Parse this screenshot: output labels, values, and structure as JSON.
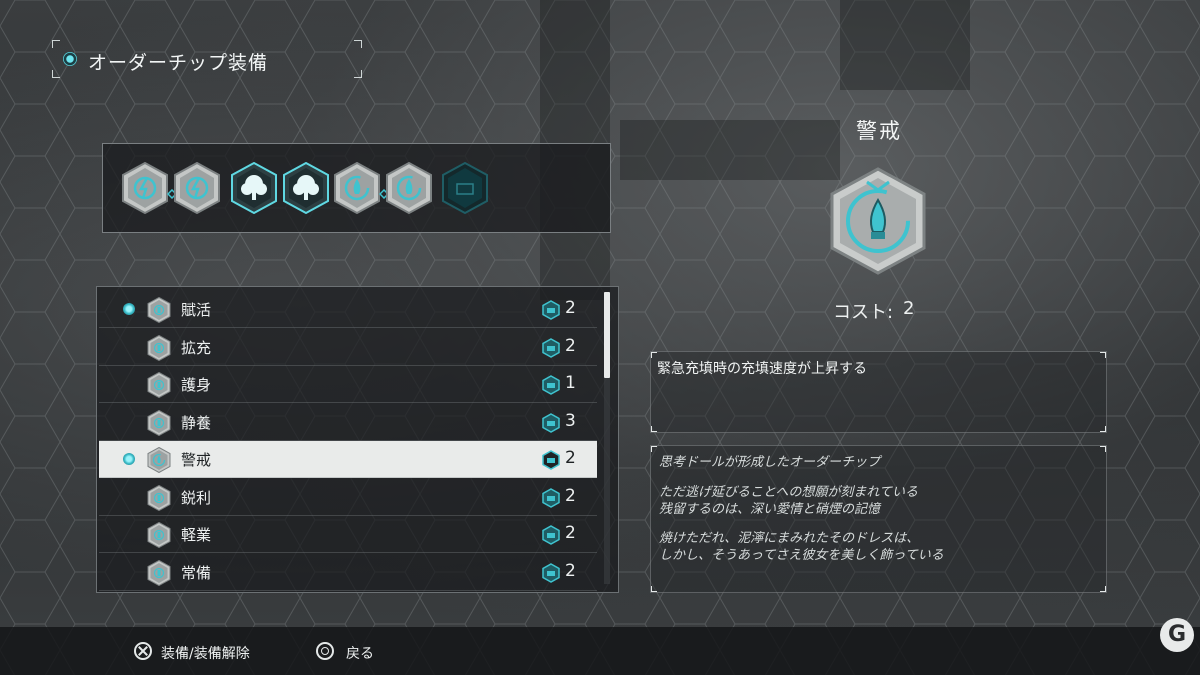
{
  "header": {
    "title": "オーダーチップ装備"
  },
  "equipped_slots": [
    {
      "icon": "lightning-chip-icon",
      "style": "silver",
      "linked_next": true
    },
    {
      "icon": "lightning-chip-icon",
      "style": "silver",
      "linked_next": false
    },
    {
      "icon": "tree-chip-icon",
      "style": "teal",
      "linked_next": false
    },
    {
      "icon": "tree-chip-icon",
      "style": "teal",
      "linked_next": false
    },
    {
      "icon": "flame-chip-icon",
      "style": "silver",
      "linked_next": true
    },
    {
      "icon": "flame-chip-icon",
      "style": "silver",
      "linked_next": false
    },
    {
      "icon": "empty-slot-icon",
      "style": "empty",
      "linked_next": false
    }
  ],
  "chip_list": [
    {
      "name": "賦活",
      "cost": "2",
      "equipped": true,
      "selected": false
    },
    {
      "name": "拡充",
      "cost": "2",
      "equipped": false,
      "selected": false
    },
    {
      "name": "護身",
      "cost": "1",
      "equipped": false,
      "selected": false
    },
    {
      "name": "静養",
      "cost": "3",
      "equipped": false,
      "selected": false
    },
    {
      "name": "警戒",
      "cost": "2",
      "equipped": true,
      "selected": true
    },
    {
      "name": "鋭利",
      "cost": "2",
      "equipped": false,
      "selected": false
    },
    {
      "name": "軽業",
      "cost": "2",
      "equipped": false,
      "selected": false
    },
    {
      "name": "常備",
      "cost": "2",
      "equipped": false,
      "selected": false
    }
  ],
  "detail": {
    "name": "警戒",
    "cost_label": "コスト:",
    "cost_value": "2",
    "effect": "緊急充填時の充填速度が上昇する",
    "lore": [
      "思考ドールが形成したオーダーチップ",
      "ただ逃げ延びることへの想願が刻まれている",
      "残留するのは、深い愛情と硝煙の記憶",
      "焼けただれ、泥濘にまみれたそのドレスは、",
      "しかし、そうあってさえ彼女を美しく飾っている"
    ]
  },
  "footer": {
    "equip_label": "装備/装備解除",
    "back_label": "戻る"
  },
  "colors": {
    "accent": "#3fc3cf",
    "selected_row": "#e9ebea",
    "panel": "#1a1c1e"
  }
}
